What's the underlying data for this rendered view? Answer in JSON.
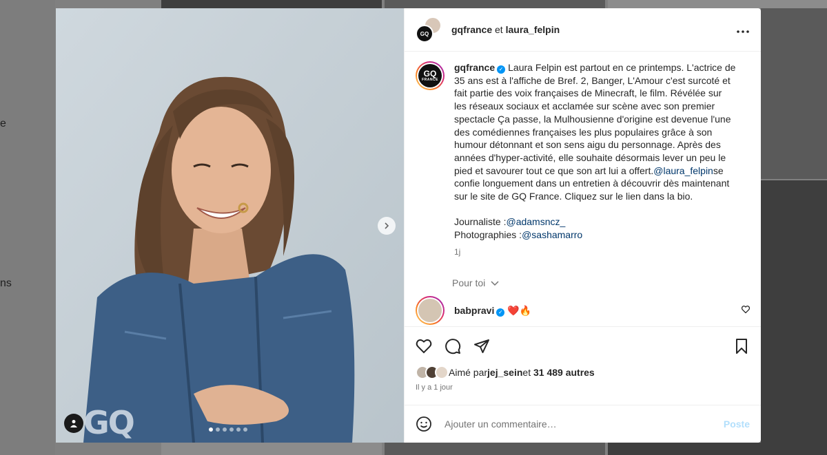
{
  "background": {
    "left_fragments": [
      "e",
      "ns"
    ]
  },
  "header": {
    "user1": "gqfrance",
    "conjunction": "et",
    "user2": "laura_felpin"
  },
  "media": {
    "watermark": "GQ",
    "carousel_count": 6,
    "carousel_active": 1
  },
  "caption": {
    "username": "gqfrance",
    "text_before_mention": "Laura Felpin est partout en ce printemps. L'actrice de 35 ans est à l'affiche de Bref. 2, Banger, L'Amour c'est surcoté et fait partie des voix françaises de Minecraft, le film. Révélée sur les réseaux sociaux et acclamée sur scène avec son premier spectacle Ça passe, la Mulhousienne d'origine est devenue l'une des comédiennes françaises les plus populaires grâce à son humour détonnant et son sens aigu du personnage. Après des années d'hyper-activité, elle souhaite désormais lever un peu le pied et savourer tout ce que son art lui a offert.",
    "mention": "@laura_felpin",
    "text_after_mention": "se confie longuement dans un entretien à découvrir dès maintenant sur le site de GQ France. Cliquez sur le lien dans la bio.",
    "journalist_label": "Journaliste :",
    "journalist": "@adamsncz_",
    "photographer_label": "Photographies :",
    "photographer": "@sashamarro",
    "time": "1j"
  },
  "for_you_label": "Pour toi",
  "comment": {
    "username": "babpravi",
    "text": "❤️🔥"
  },
  "likes": {
    "prefix": "Aimé par",
    "user": "jej_sein",
    "middle": "et",
    "others": "31 489 autres"
  },
  "post_date": "Il y a 1 jour",
  "add_comment": {
    "placeholder": "Ajouter un commentaire…",
    "post_label": "Poste"
  }
}
